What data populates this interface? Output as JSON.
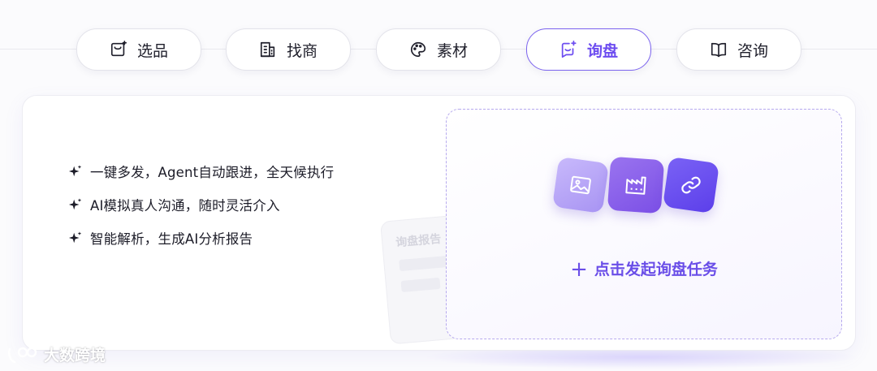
{
  "tabs": [
    {
      "label": "选品",
      "icon": "product-bag-icon",
      "active": false
    },
    {
      "label": "找商",
      "icon": "building-icon",
      "active": false
    },
    {
      "label": "素材",
      "icon": "palette-icon",
      "active": false
    },
    {
      "label": "询盘",
      "icon": "chat-sparkle-icon",
      "active": true
    },
    {
      "label": "咨询",
      "icon": "book-icon",
      "active": false
    }
  ],
  "features": [
    "一键多发，Agent自动跟进，全天候执行",
    "AI模拟真人沟通，随时灵活介入",
    "智能解析，生成AI分析报告"
  ],
  "ghost_card": {
    "title": "询盘报告"
  },
  "dropzone": {
    "cta_plus": "+",
    "cta_label": "点击发起询盘任务",
    "tiles": [
      "image-icon",
      "factory-icon",
      "link-icon"
    ]
  },
  "watermark": {
    "text": "大数跨境"
  },
  "colors": {
    "accent": "#6d4df0",
    "border_dashed": "#b6a9ee"
  }
}
